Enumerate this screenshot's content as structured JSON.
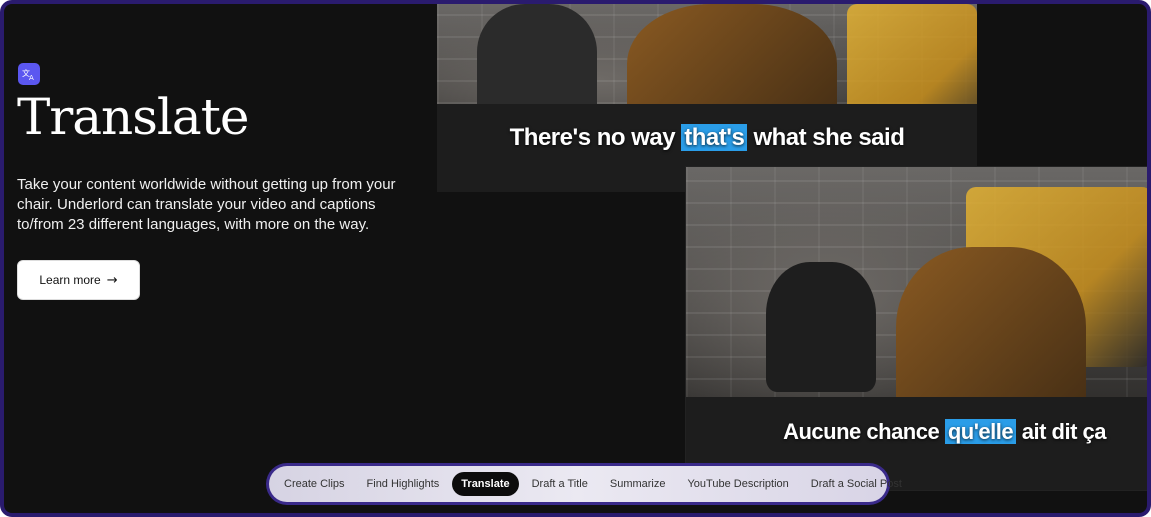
{
  "feature": {
    "icon": "translate-icon",
    "title": "Translate",
    "description": "Take your content worldwide without getting up from your chair. Underlord can translate your video and captions to/from 23 different languages, with more on the way.",
    "cta_label": "Learn more",
    "cta_icon": "arrow-right-icon"
  },
  "captions": {
    "original_before": "There's no way ",
    "original_highlight": "that's",
    "original_after": " what she said",
    "translated_before": "Aucune chance ",
    "translated_highlight": "qu'elle",
    "translated_after": " ait dit ça"
  },
  "tabs": [
    {
      "label": "Create Clips",
      "active": false
    },
    {
      "label": "Find Highlights",
      "active": false
    },
    {
      "label": "Translate",
      "active": true
    },
    {
      "label": "Draft a Title",
      "active": false
    },
    {
      "label": "Summarize",
      "active": false
    },
    {
      "label": "YouTube Description",
      "active": false
    },
    {
      "label": "Draft a Social Post",
      "active": false
    }
  ],
  "colors": {
    "frame_border": "#2a1b6e",
    "background": "#111111",
    "badge": "#5b57f0",
    "caption_highlight": "#2a9de8",
    "active_tab": "#0c0c0c"
  }
}
